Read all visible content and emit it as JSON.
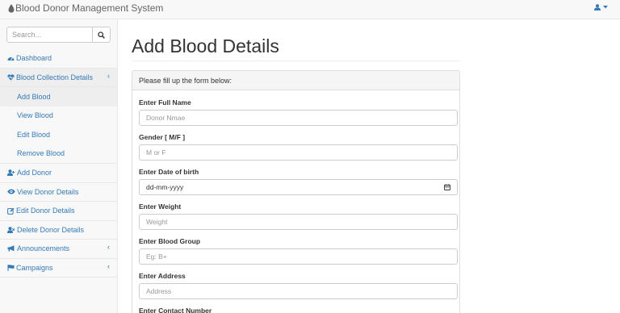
{
  "app": {
    "title": "Blood Donor Management System"
  },
  "search": {
    "placeholder": "Search..."
  },
  "sidebar": {
    "items": [
      {
        "label": "Dashboard"
      },
      {
        "label": "Blood Collection Details",
        "caret": "‹"
      },
      {
        "label": "Add Blood"
      },
      {
        "label": "View Blood"
      },
      {
        "label": "Edit Blood"
      },
      {
        "label": "Remove Blood"
      },
      {
        "label": "Add Donor"
      },
      {
        "label": "View Donor Details"
      },
      {
        "label": "Edit Donor Details"
      },
      {
        "label": "Delete Donor Details"
      },
      {
        "label": "Announcements",
        "caret": "‹"
      },
      {
        "label": "Campaigns",
        "caret": "‹"
      }
    ]
  },
  "main": {
    "page_title": "Add Blood Details",
    "panel_heading": "Please fill up the form below:",
    "fields": [
      {
        "label": "Enter Full Name",
        "placeholder": "Donor Nmae"
      },
      {
        "label": "Gender [ M/F ]",
        "placeholder": "M or F"
      },
      {
        "label": "Enter Date of birth",
        "value": "dd-mm-yyyy"
      },
      {
        "label": "Enter Weight",
        "placeholder": "Weight"
      },
      {
        "label": "Enter Blood Group",
        "placeholder": "Eg: B+"
      },
      {
        "label": "Enter Address",
        "placeholder": "Address"
      },
      {
        "label": "Enter Contact Number"
      }
    ]
  },
  "colors": {
    "link": "#337ab7",
    "navbar_bg": "#f8f8f8",
    "border": "#e7e7e7",
    "active_bg": "#eeeeee"
  },
  "icons": [
    "blood-drop-icon",
    "user-icon",
    "caret-down-icon",
    "search-icon",
    "dashboard-icon",
    "heartbeat-icon",
    "user-plus-icon",
    "eye-icon",
    "edit-icon",
    "user-times-icon",
    "bullhorn-icon",
    "flag-icon",
    "calendar-icon"
  ]
}
